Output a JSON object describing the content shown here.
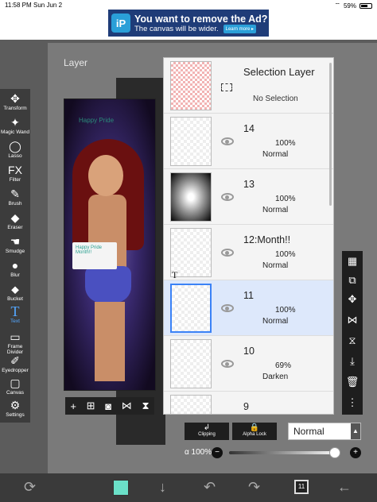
{
  "status": {
    "time": "11:58 PM",
    "date": "Sun Jun 2",
    "battery": "59%"
  },
  "ad": {
    "logo": "iP",
    "title": "You want to remove the Ad?",
    "subtitle": "The canvas will be wider.",
    "button": "Learn more ▸"
  },
  "panel": {
    "heading": "Layer"
  },
  "artwork": {
    "title": "Happy Pride",
    "sign": "Happy Pride Month!!"
  },
  "tools": [
    {
      "label": "Transform",
      "icon": "✥"
    },
    {
      "label": "Magic Wand",
      "icon": "✦"
    },
    {
      "label": "Lasso",
      "icon": "◯"
    },
    {
      "label": "Filter",
      "icon": "FX"
    },
    {
      "label": "Brush",
      "icon": "✎"
    },
    {
      "label": "Eraser",
      "icon": "◆"
    },
    {
      "label": "Smudge",
      "icon": "☚"
    },
    {
      "label": "Blur",
      "icon": "●"
    },
    {
      "label": "Bucket",
      "icon": "⬥"
    },
    {
      "label": "Text",
      "icon": "T"
    },
    {
      "label": "Frame Divider",
      "icon": "▭"
    },
    {
      "label": "Eyedropper",
      "icon": "✐"
    },
    {
      "label": "Canvas",
      "icon": "▢"
    },
    {
      "label": "Settings",
      "icon": "⚙"
    }
  ],
  "layers": [
    {
      "name": "Selection Layer",
      "sub": "No Selection"
    },
    {
      "name": "14",
      "opacity": "100%",
      "blend": "Normal"
    },
    {
      "name": "13",
      "opacity": "100%",
      "blend": "Normal"
    },
    {
      "name": "12:Month!!",
      "opacity": "100%",
      "blend": "Normal"
    },
    {
      "name": "11",
      "opacity": "100%",
      "blend": "Normal"
    },
    {
      "name": "10",
      "opacity": "69%",
      "blend": "Darken"
    },
    {
      "name": "9"
    }
  ],
  "text_marker": "T",
  "controls": {
    "clipping": "Clipping",
    "alpha_lock": "Alpha Lock",
    "blend_mode": "Normal",
    "alpha_label": "α 100%",
    "alpha_value": 1.0,
    "minus": "−",
    "plus": "+"
  },
  "bottom": {
    "layer_count": "11",
    "swatch_color": "#6be0c8"
  }
}
